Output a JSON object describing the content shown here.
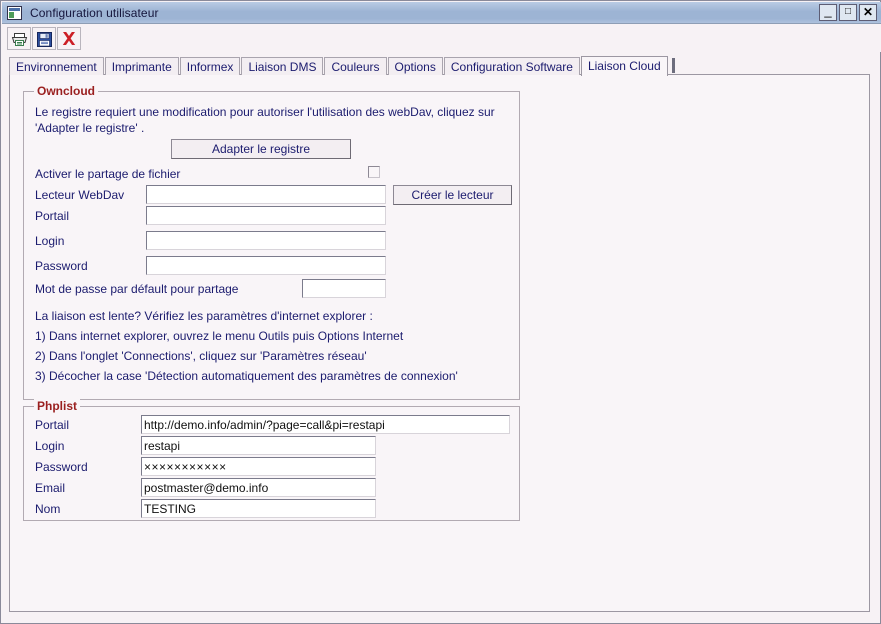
{
  "window": {
    "title": "Configuration utilisateur",
    "icon": "app-window-icon",
    "min_label": "_",
    "max_label": "□",
    "close_label": "✕"
  },
  "toolbar": {
    "buttons": [
      {
        "name": "print-button",
        "icon": "printer-icon"
      },
      {
        "name": "save-button",
        "icon": "floppy-disk-icon"
      },
      {
        "name": "close-button",
        "icon": "red-x-icon"
      }
    ]
  },
  "tabs": [
    {
      "label": "Environnement",
      "active": false
    },
    {
      "label": "Imprimante",
      "active": false
    },
    {
      "label": "Informex",
      "active": false
    },
    {
      "label": "Liaison DMS",
      "active": false
    },
    {
      "label": "Couleurs",
      "active": false
    },
    {
      "label": "Options",
      "active": false
    },
    {
      "label": "Configuration Software",
      "active": false
    },
    {
      "label": "Liaison Cloud",
      "active": true
    }
  ],
  "owncloud": {
    "title": "Owncloud",
    "notice_line1": "Le registre requiert une modification pour autoriser l'utilisation des webDav, cliquez sur",
    "notice_line2": "'Adapter le registre' .",
    "adapt_button": "Adapter le registre",
    "share_checkbox_label": "Activer le partage de fichier",
    "share_checkbox_checked": false,
    "webdav_label": "Lecteur WebDav",
    "webdav_value": "",
    "webdav_placeholder": "",
    "create_drive_button": "Créer le lecteur",
    "portail_label": "Portail",
    "portail_value": "",
    "login_label": "Login",
    "login_value": "",
    "password_label": "Password",
    "password_value": "",
    "default_share_pwd_label": "Mot de passe par défault pour partage",
    "default_share_pwd_value": "",
    "help_line0": "La liaison est lente? Vérifiez les paramètres d'internet explorer :",
    "help_line1": "1) Dans internet explorer, ouvrez le menu Outils puis Options Internet",
    "help_line2": "2) Dans l'onglet 'Connections', cliquez sur 'Paramètres réseau'",
    "help_line3": "3) Décocher la case 'Détection automatiquement des paramètres de connexion'"
  },
  "phplist": {
    "title": "Phplist",
    "portail_label": "Portail",
    "portail_value": "http://demo.info/admin/?page=call&pi=restapi",
    "login_label": "Login",
    "login_value": "restapi",
    "password_label": "Password",
    "password_value": "×××××××××××",
    "email_label": "Email",
    "email_value": "postmaster@demo.info",
    "nom_label": "Nom",
    "nom_value": "TESTING"
  },
  "colors": {
    "titlebar": "#9db4d4",
    "panel_bg": "#f9f5f8",
    "label_text": "#1b1b6e",
    "group_title": "#9a1f1f",
    "field_bg": "#ffffff"
  }
}
